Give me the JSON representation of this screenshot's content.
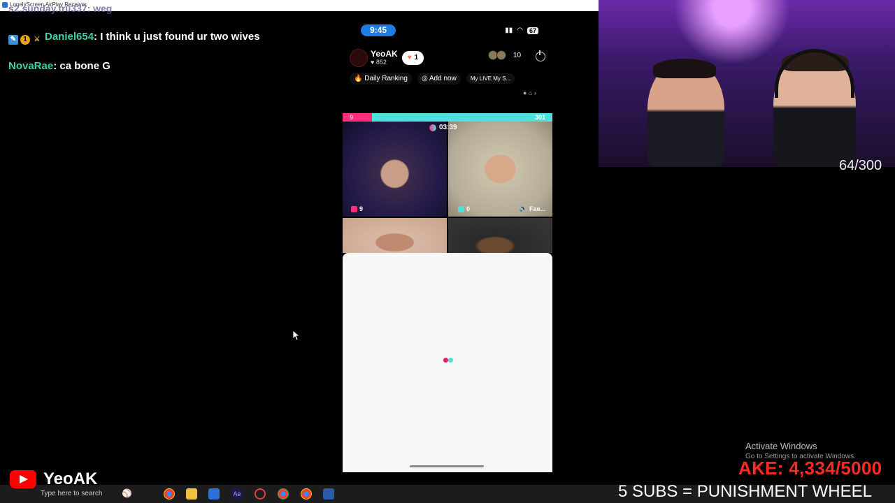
{
  "window": {
    "title": "LonelyScreen AirPlay Receiver"
  },
  "chat": {
    "faded_line": "s2.sunday.tr0337: weg",
    "messages": [
      {
        "name": "Daniel654",
        "text": ": I think u just found ur two wives",
        "badges": [
          "mod-icon",
          "rank-icon",
          "sword-icon"
        ]
      },
      {
        "name": "NovaRae",
        "text": ": ca bone G",
        "badges": []
      }
    ]
  },
  "phone": {
    "time": "9:45",
    "battery": "67",
    "host": {
      "name": "YeoAK",
      "likes": "852",
      "follow_count": "1"
    },
    "viewers": "10",
    "rank_label": "Daily Ranking",
    "add_label": "Add now",
    "mylive_label": "My LIVE My S...",
    "battle": {
      "left_score": "9",
      "right_score": "301",
      "timer": "03:39"
    },
    "cams": [
      {
        "label": "9"
      },
      {
        "label": "0",
        "extra": "Fae..."
      }
    ],
    "accent_pink": "#ff2d7a",
    "accent_cyan": "#4fe0de"
  },
  "overlay": {
    "counter": "64/300",
    "activate_title": "Activate Windows",
    "activate_sub": "Go to Settings to activate Windows.",
    "goal": "AKE: 4,334/5000",
    "punishment": "5 SUBS = PUNISHMENT WHEEL",
    "channel_name": "YeoAK"
  },
  "taskbar": {
    "search_placeholder": "Type here to search",
    "apps": [
      "windows-icon",
      "search-icon",
      "baseball-icon",
      "chrome-icon",
      "file-explorer-icon",
      "store-icon",
      "after-effects-icon",
      "app-icon",
      "chrome-icon",
      "chrome-icon",
      "airplay-icon"
    ]
  }
}
